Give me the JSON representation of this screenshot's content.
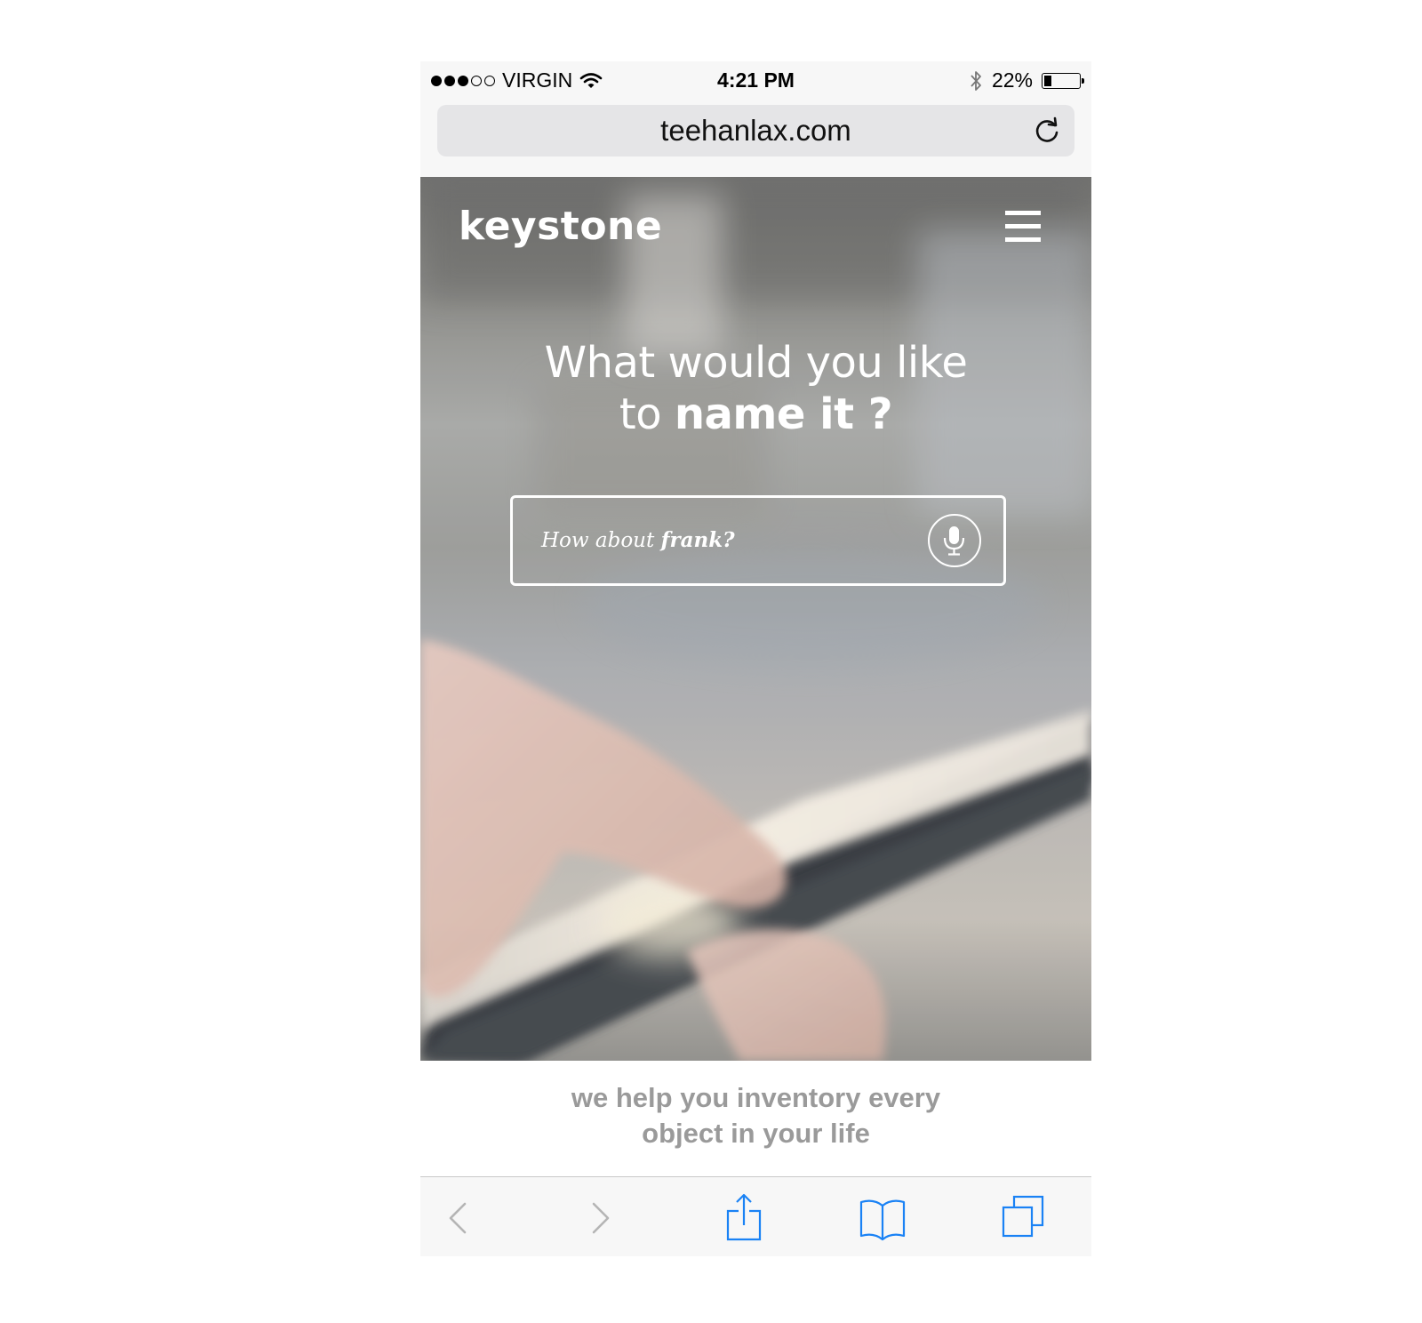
{
  "status_bar": {
    "carrier": "VIRGIN",
    "time": "4:21 PM",
    "battery_percent": "22%",
    "battery_level": 0.22,
    "signal_bars_filled": 3,
    "signal_bars_total": 5
  },
  "address_bar": {
    "url": "teehanlax.com"
  },
  "site": {
    "logo": "keystone",
    "headline_line1": "What would you like",
    "headline_line2_prefix": "to ",
    "headline_line2_bold": "name it ?",
    "search": {
      "placeholder_prefix": "How about ",
      "placeholder_bold": "frank?"
    },
    "tagline_line1": "we help you inventory every",
    "tagline_line2": "object in your life"
  },
  "toolbar": {
    "items": [
      "back",
      "forward",
      "share",
      "bookmarks",
      "tabs"
    ]
  },
  "colors": {
    "ios_blue": "#1a82f5",
    "disabled_gray": "#b5b5b5",
    "tagline_gray": "#9a9a9a"
  }
}
